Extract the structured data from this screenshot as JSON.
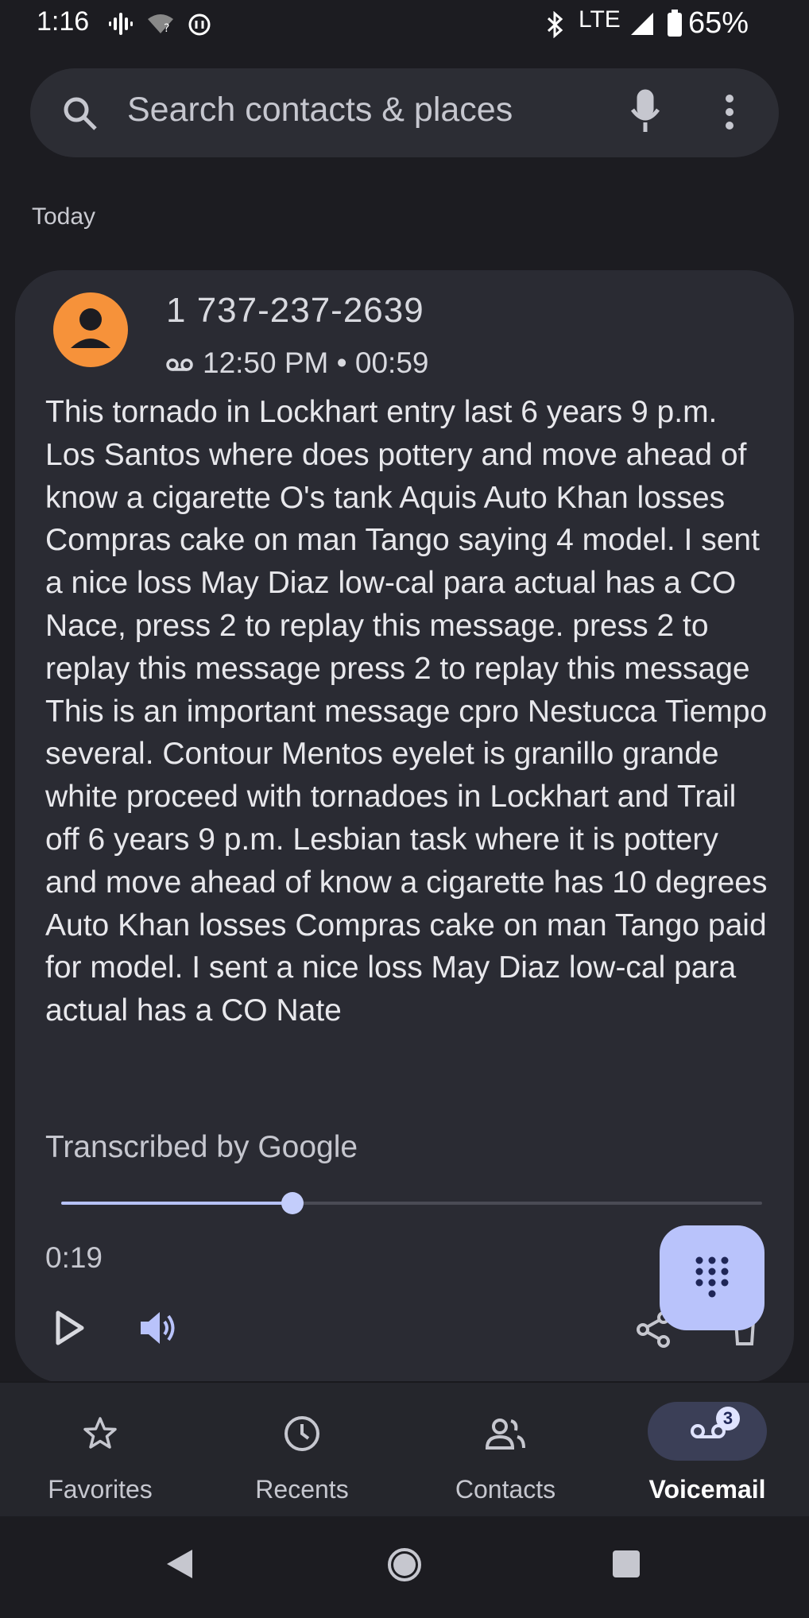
{
  "status_bar": {
    "time": "1:16",
    "network": "LTE",
    "battery": "65%"
  },
  "search": {
    "placeholder": "Search contacts & places",
    "icon": "search-icon",
    "mic_icon": "mic-icon",
    "menu_icon": "more-vert-icon"
  },
  "section": {
    "label": "Today"
  },
  "voicemail": {
    "caller": "1 737-237-2639",
    "time": "12:50 PM",
    "separator": "•",
    "duration": "00:59",
    "transcript": "This tornado in Lockhart entry last 6 years 9 p.m. Los Santos where does pottery and move ahead of know a cigarette O's tank Aquis Auto Khan losses Compras cake on man Tango saying 4 model. I sent a nice loss May Diaz low-cal para actual has a CO Nace, press 2 to replay this message. press 2 to replay this message press 2 to replay this message This is an important message cpro Nestucca Tiempo several. Contour Mentos eyelet is granillo grande white proceed with tornadoes in Lockhart and Trail off 6 years 9 p.m. Lesbian task where it is pottery and move ahead of know a cigarette has 10 degrees Auto Khan losses Compras cake on man Tango paid for model. I sent a nice loss May Diaz low-cal para actual has a CO Nate",
    "transcribed_by": "Transcribed by Google",
    "elapsed": "0:19",
    "progress_fraction": 0.33
  },
  "bottom_nav": {
    "items": [
      {
        "label": "Favorites",
        "icon": "star-icon"
      },
      {
        "label": "Recents",
        "icon": "clock-icon"
      },
      {
        "label": "Contacts",
        "icon": "people-icon"
      },
      {
        "label": "Voicemail",
        "icon": "voicemail-icon",
        "badge": "3",
        "active": true
      }
    ]
  },
  "colors": {
    "accent": "#b9c3fb",
    "avatar": "#f6923a",
    "background": "#1c1c21",
    "card": "#2a2b33"
  }
}
